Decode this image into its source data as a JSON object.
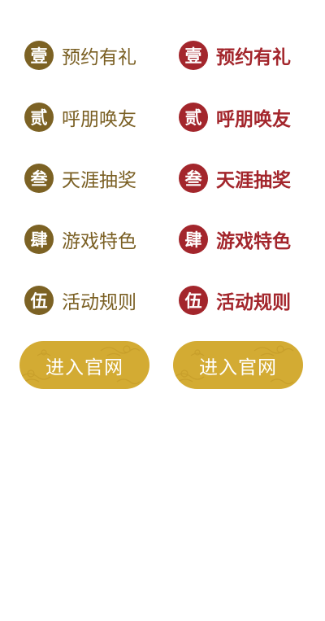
{
  "left_column": {
    "items": [
      {
        "badge": "壹",
        "label": "预约有礼"
      },
      {
        "badge": "贰",
        "label": "呼朋唤友"
      },
      {
        "badge": "叁",
        "label": "天涯抽奖"
      },
      {
        "badge": "肆",
        "label": "游戏特色"
      },
      {
        "badge": "伍",
        "label": "活动规则"
      }
    ],
    "official_button": "进入官网"
  },
  "right_column": {
    "items": [
      {
        "badge": "壹",
        "label": "预约有礼"
      },
      {
        "badge": "贰",
        "label": "呼朋唤友"
      },
      {
        "badge": "叁",
        "label": "天涯抽奖"
      },
      {
        "badge": "肆",
        "label": "游戏特色"
      },
      {
        "badge": "伍",
        "label": "活动规则"
      }
    ],
    "official_button": "进入官网"
  },
  "colors": {
    "normal_badge": "#7c6224",
    "normal_text": "#7a5f23",
    "active_badge": "#a3262c",
    "active_text": "#a3262c",
    "button_gold": "#d3ab33"
  }
}
